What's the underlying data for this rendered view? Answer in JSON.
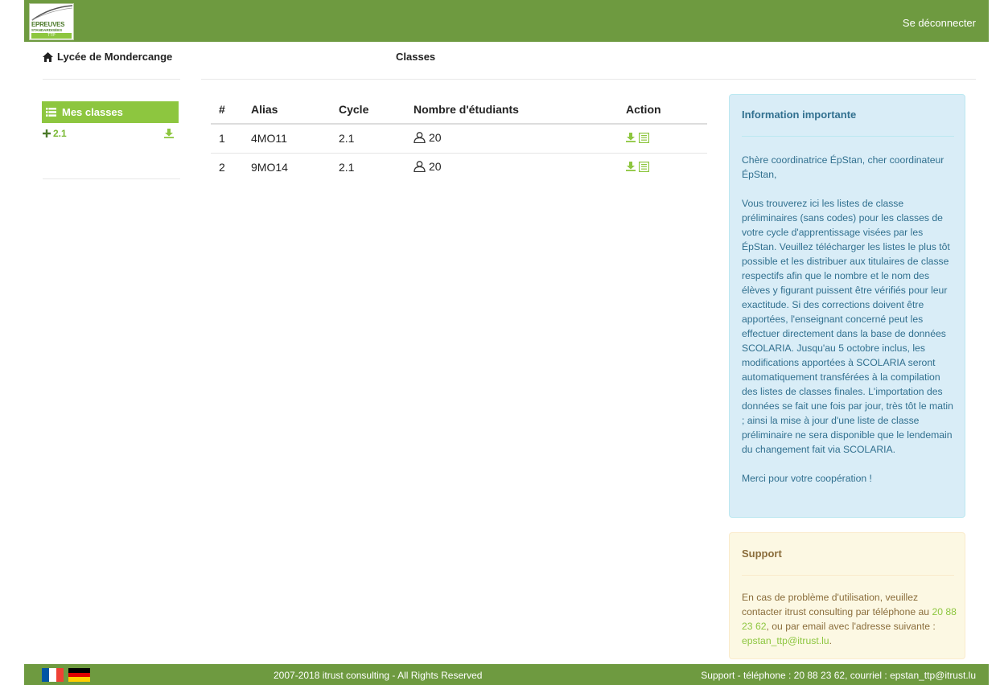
{
  "brand": {
    "logo_line1": "EPREUVES",
    "logo_line2": "STANDARDISÉES",
    "logo_line3": "TTP"
  },
  "topbar": {
    "logout_label": "Se déconnecter"
  },
  "header": {
    "school_name": "Lycée de Mondercange",
    "page_title": "Classes"
  },
  "sidebar": {
    "title": "Mes classes",
    "items": [
      {
        "label": "2.1"
      }
    ]
  },
  "table": {
    "headers": [
      "#",
      "Alias",
      "Cycle",
      "Nombre d'étudiants",
      "Action"
    ],
    "rows": [
      {
        "num": "1",
        "alias": "4MO11",
        "cycle": "2.1",
        "students": "20"
      },
      {
        "num": "2",
        "alias": "9MO14",
        "cycle": "2.1",
        "students": "20"
      }
    ]
  },
  "info": {
    "title": "Information importante",
    "p1": "Chère coordinatrice ÉpStan, cher coordinateur ÉpStan,",
    "p2": "Vous trouverez ici les listes de classe préliminaires (sans codes) pour les classes de votre cycle d'apprentissage visées par les ÉpStan. Veuillez télécharger les listes le plus tôt possible et les distribuer aux titulaires de classe respectifs afin que le nombre et le nom des élèves y figurant puissent être vérifiés pour leur exactitude. Si des corrections doivent être apportées, l'enseignant concerné peut les effectuer directement dans la base de données SCOLARIA. Jusqu'au 5 octobre inclus, les modifications apportées à SCOLARIA seront automatiquement transférées à la compilation des listes de classes finales. L'importation des données se fait une fois par jour, très tôt le matin ; ainsi la mise à jour d'une liste de classe préliminaire ne sera disponible que le lendemain du changement fait via SCOLARIA.",
    "p3": "Merci pour votre coopération !"
  },
  "support": {
    "title": "Support",
    "text_before": "En cas de problème d'utilisation, veuillez contacter itrust consulting par téléphone au ",
    "phone": "20 88 23 62",
    "text_middle": ", ou par email avec l'adresse suivante : ",
    "email": "epstan_ttp@itrust.lu",
    "text_after": "."
  },
  "footer": {
    "copyright": "2007-2018 itrust consulting - All Rights Reserved",
    "support": "Support - téléphone : 20 88 23 62, courriel : epstan_ttp@itrust.lu"
  },
  "colors": {
    "brand_green": "#6e9a40",
    "accent_green": "#8dc63f",
    "info_bg": "#d9edf7",
    "support_bg": "#fcf8e3"
  },
  "icons": {
    "home": "home-icon",
    "list": "list-icon",
    "plus": "plus-icon",
    "download": "download-icon",
    "user": "user-icon",
    "document": "document-icon"
  }
}
